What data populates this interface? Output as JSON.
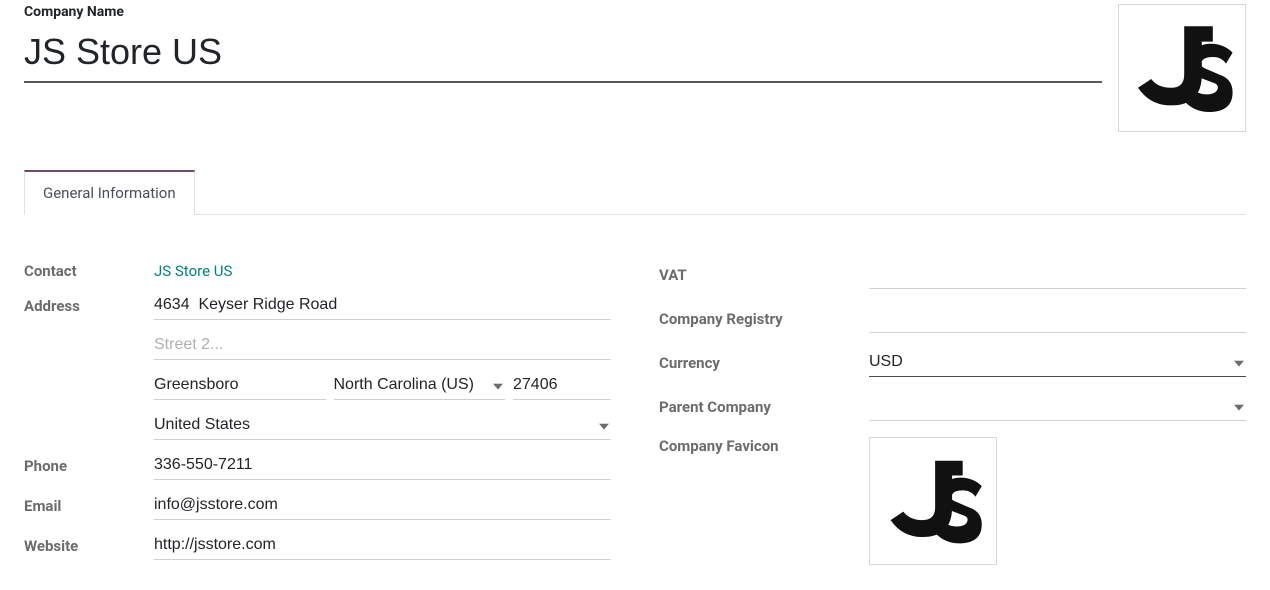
{
  "labels": {
    "company_name": "Company Name",
    "tab_general": "General Information",
    "contact": "Contact",
    "address": "Address",
    "phone": "Phone",
    "email": "Email",
    "website": "Website",
    "vat": "VAT",
    "company_registry": "Company Registry",
    "currency": "Currency",
    "parent_company": "Parent Company",
    "company_favicon": "Company Favicon"
  },
  "company": {
    "name": "JS Store US",
    "contact": "JS Store US",
    "address": {
      "street": "4634  Keyser Ridge Road",
      "street2": "",
      "street2_placeholder": "Street 2...",
      "city": "Greensboro",
      "state": "North Carolina (US)",
      "zip": "27406",
      "country": "United States"
    },
    "phone": "336-550-7211",
    "email": "info@jsstore.com",
    "website": "http://jsstore.com",
    "vat": "",
    "company_registry": "",
    "currency": "USD",
    "parent_company": ""
  }
}
